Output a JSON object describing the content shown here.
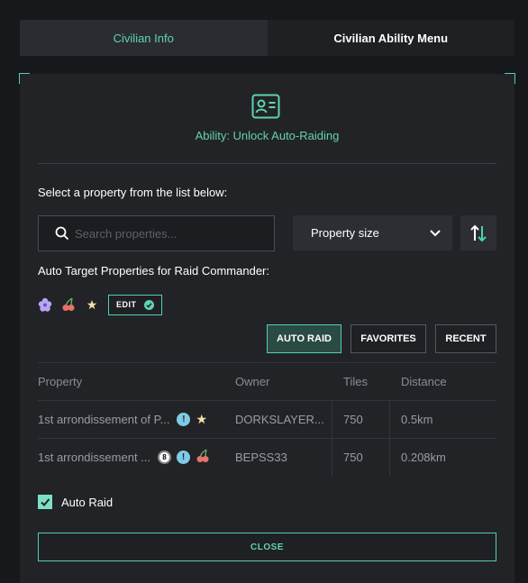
{
  "tabs": [
    {
      "label": "Civilian Info",
      "active": false
    },
    {
      "label": "Civilian Ability Menu",
      "active": true
    }
  ],
  "ability": {
    "icon": "id-card-icon",
    "title": "Ability: Unlock Auto-Raiding"
  },
  "select_label": "Select a property from the list below:",
  "search": {
    "placeholder": "Search properties...",
    "value": ""
  },
  "sort_dropdown": {
    "selected": "Property size"
  },
  "auto_target_label": "Auto Target Properties for Raid Commander:",
  "favorite_icons": [
    "flower-icon",
    "cherry-icon",
    "star-icon"
  ],
  "edit_label": "EDIT",
  "filters": [
    {
      "label": "AUTO RAID",
      "active": true
    },
    {
      "label": "FAVORITES",
      "active": false
    },
    {
      "label": "RECENT",
      "active": false
    }
  ],
  "table": {
    "columns": [
      "Property",
      "Owner",
      "Tiles",
      "Distance"
    ],
    "rows": [
      {
        "property": "1st arrondissement of P...",
        "badges": [
          "exclamation-icon",
          "star-icon"
        ],
        "owner": "DORKSLAYER...",
        "tiles": "750",
        "distance": "0.5km"
      },
      {
        "property": "1st arrondissement ...",
        "badges": [
          "eight-ball-icon",
          "exclamation-icon",
          "cherry-icon"
        ],
        "owner": "BEPSS33",
        "tiles": "750",
        "distance": "0.208km"
      }
    ]
  },
  "auto_raid": {
    "label": "Auto Raid",
    "checked": true
  },
  "close_label": "CLOSE",
  "colors": {
    "accent": "#4fd1ae",
    "background": "#17181b",
    "panel": "#222327"
  }
}
